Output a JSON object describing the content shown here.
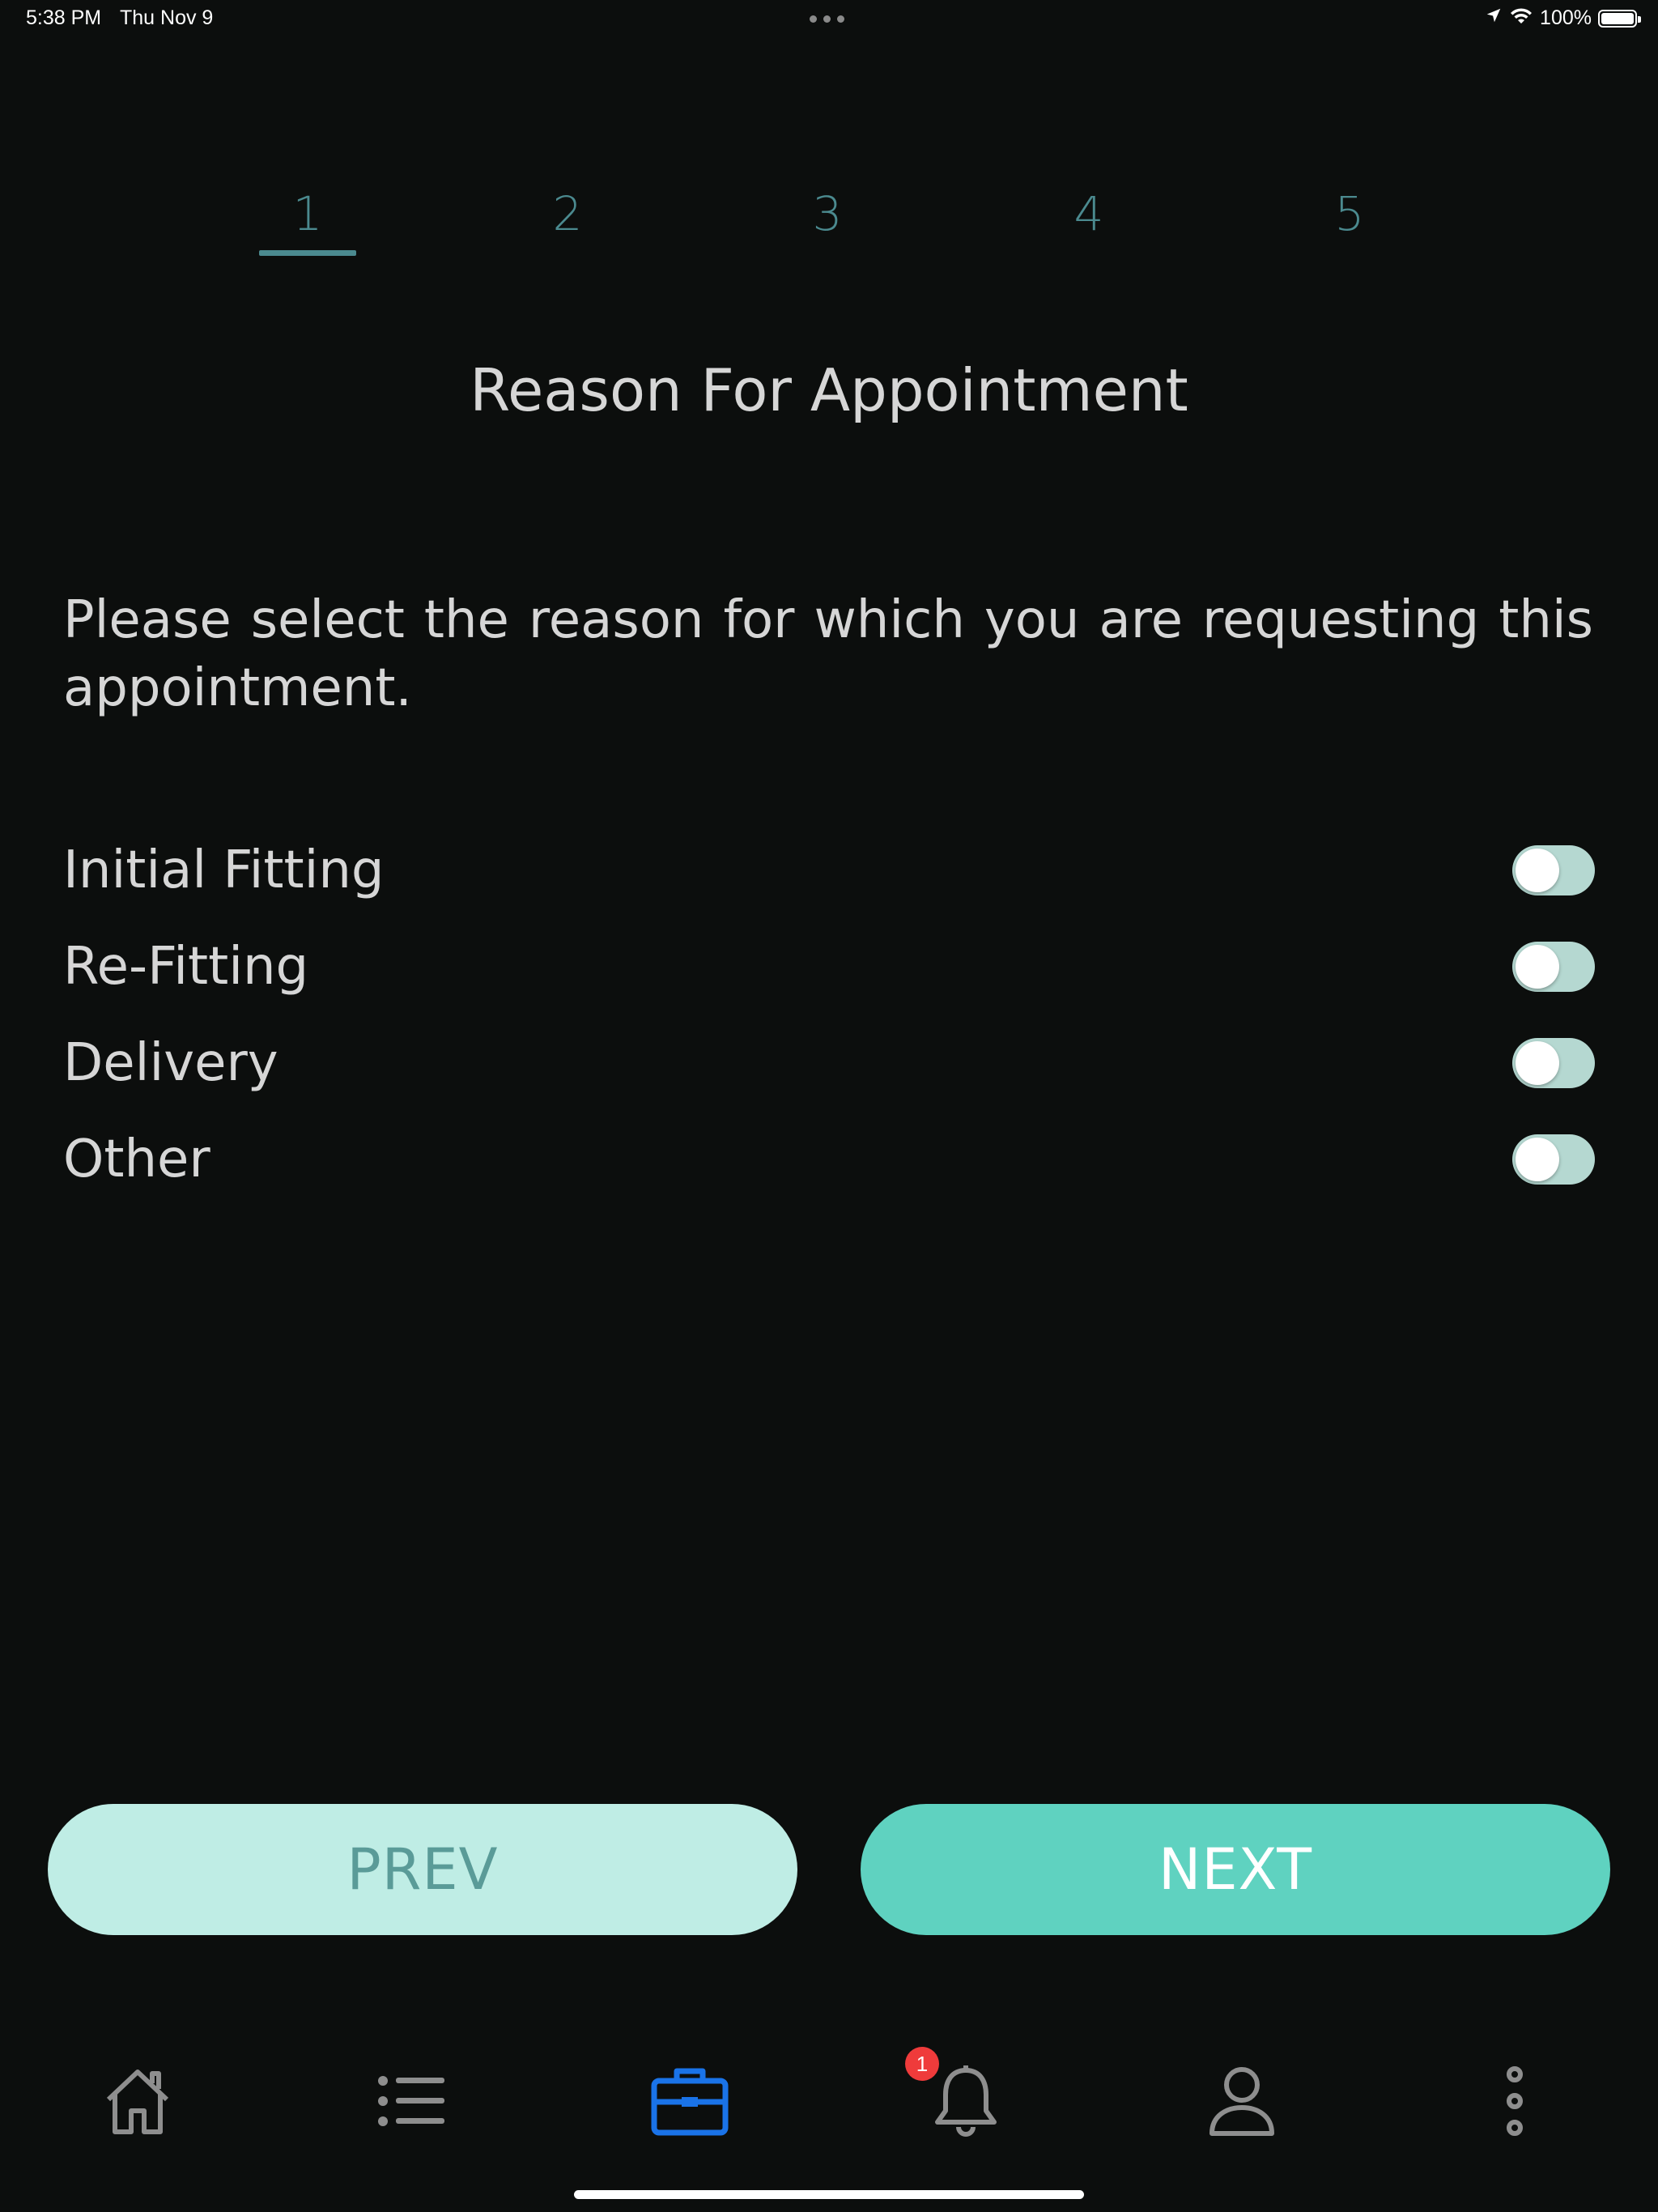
{
  "status_bar": {
    "time": "5:38 PM",
    "date": "Thu Nov 9",
    "battery": "100%",
    "icons": [
      "location-icon",
      "wifi-icon",
      "battery-icon"
    ]
  },
  "stepper": {
    "steps": [
      "1",
      "2",
      "3",
      "4",
      "5"
    ],
    "active_step": "1",
    "accent_color": "#4b8a8f"
  },
  "page": {
    "title": "Reason For Appointment",
    "instruction": "Please select the reason for which you are requesting this appointment."
  },
  "options": [
    {
      "label": "Initial Fitting",
      "checked": false
    },
    {
      "label": "Re-Fitting",
      "checked": false
    },
    {
      "label": "Delivery",
      "checked": false
    },
    {
      "label": "Other",
      "checked": false
    }
  ],
  "buttons": {
    "prev_label": "PREV",
    "next_label": "NEXT",
    "prev_color": "#bfede5",
    "next_color": "#5fd2c0"
  },
  "tabbar": {
    "items": [
      {
        "icon": "home-icon",
        "active": false
      },
      {
        "icon": "list-icon",
        "active": false
      },
      {
        "icon": "briefcase-icon",
        "active": true
      },
      {
        "icon": "bell-icon",
        "active": false,
        "badge": "1"
      },
      {
        "icon": "user-icon",
        "active": false
      },
      {
        "icon": "more-vertical-icon",
        "active": false
      }
    ],
    "active_color": "#1a73e8"
  }
}
